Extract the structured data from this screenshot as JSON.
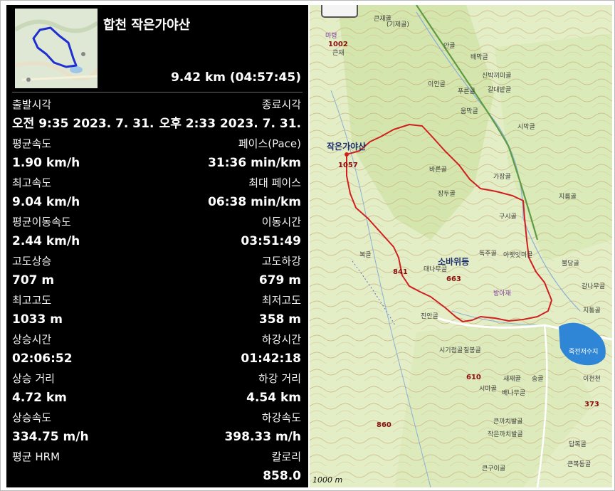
{
  "activity": {
    "title": "합천 작은가야산",
    "summary": "9.42 km (04:57:45)"
  },
  "stats": [
    {
      "left_label": "출발시각",
      "left_value": "오전 9:35 2023. 7. 31.",
      "right_label": "종료시각",
      "right_value": "오후 2:33 2023. 7. 31."
    },
    {
      "left_label": "평균속도",
      "left_value": "1.90 km/h",
      "right_label": "페이스(Pace)",
      "right_value": "31:36 min/km"
    },
    {
      "left_label": "최고속도",
      "left_value": "9.04 km/h",
      "right_label": "최대 페이스",
      "right_value": "06:38 min/km"
    },
    {
      "left_label": "평균이동속도",
      "left_value": "2.44 km/h",
      "right_label": "이동시간",
      "right_value": "03:51:49"
    },
    {
      "left_label": "고도상승",
      "left_value": "707 m",
      "right_label": "고도하강",
      "right_value": "679 m"
    },
    {
      "left_label": "최고고도",
      "left_value": "1033 m",
      "right_label": "최저고도",
      "right_value": "358 m"
    },
    {
      "left_label": "상승시간",
      "left_value": "02:06:52",
      "right_label": "하강시간",
      "right_value": "01:42:18"
    },
    {
      "left_label": "상승 거리",
      "left_value": "4.72 km",
      "right_label": "하강 거리",
      "right_value": "4.54 km"
    },
    {
      "left_label": "상승속도",
      "left_value": "334.75 m/h",
      "right_label": "하강속도",
      "right_value": "398.33 m/h"
    },
    {
      "left_label": "평균 HRM",
      "left_value": "",
      "right_label": "칼로리",
      "right_value": "858.0"
    }
  ],
  "map": {
    "labels": {
      "peak_name": "작은가야산",
      "peak_elev": "1057",
      "mountain": "소바위등",
      "elev_841": "841",
      "elev_663": "663",
      "elev_1002": "1002",
      "elev_610": "610",
      "elev_860": "860",
      "elev_373": "373",
      "reservoir": "죽전저수지",
      "pass": "방아재",
      "majae": "마령",
      "keunjae": "큰재",
      "gijae": "(기제골)",
      "jaegol": "큰재골",
      "ain": "안골",
      "baemak": "배막골",
      "sinbak": "신박끼미골",
      "galdae": "갈대밭골",
      "pureun": "푸른골",
      "iin": "이인골",
      "ummak": "움막골",
      "simak": "시막골",
      "gajang": "가장골",
      "barun": "바른골",
      "jirun": "지름골",
      "gusi": "구시골",
      "dukjeol": "독주골",
      "akbeot": "아랫잇미골",
      "bultang": "불당골",
      "gamna": "감나무골",
      "jiseong": "지통골",
      "daenamu": "대나무골",
      "jinan": "진안골",
      "sigi": "시기점골",
      "chilbong": "칠봉골",
      "saejae": "새재골",
      "songgol": "송골",
      "simagol": "시마골",
      "baena": "배나무골",
      "keunkkachi": "큰까치발골",
      "jageunkkachi": "작은까치발골",
      "keungu": "큰구이골",
      "dapbok": "답복골",
      "keunbok": "큰복동골",
      "ichon": "이천천",
      "jangdu": "장두골",
      "bok": "복골",
      "jeulbang": "줄방"
    },
    "scale": "1000 m",
    "route_color": "#d01f1f",
    "thumb_route_color": "#1f2fd0"
  }
}
